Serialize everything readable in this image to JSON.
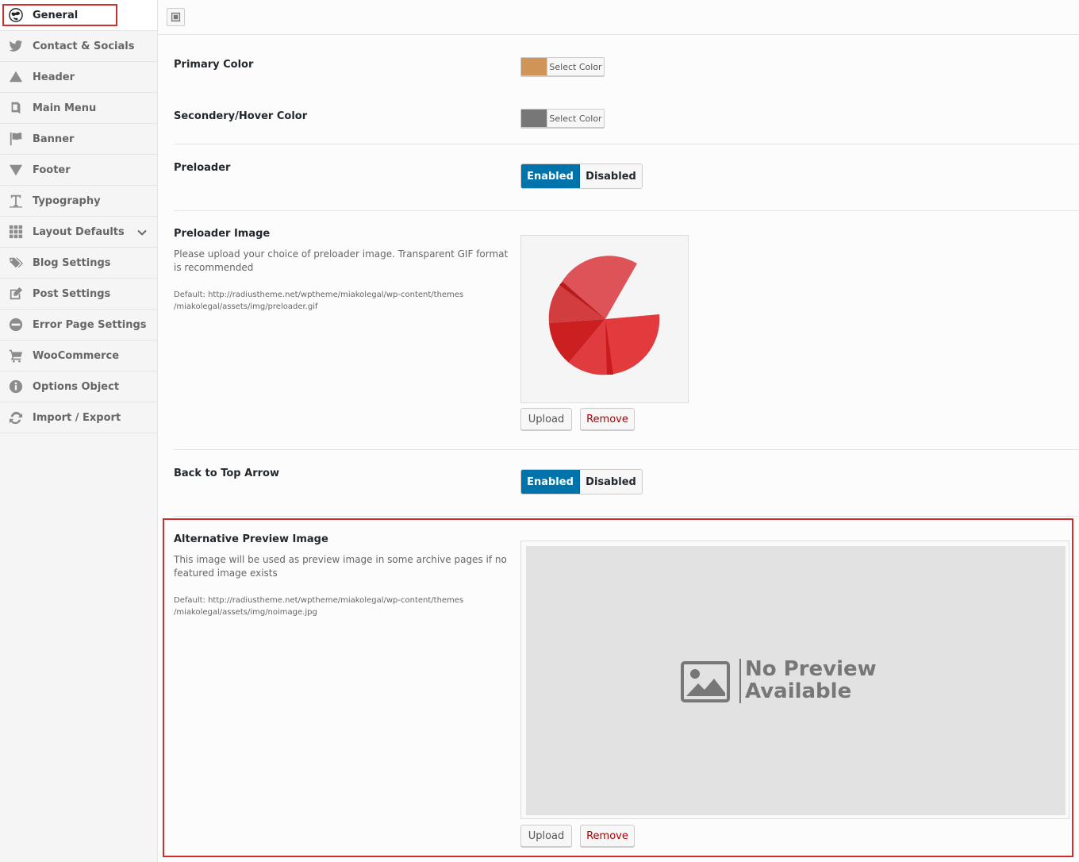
{
  "sidebar": {
    "items": [
      {
        "label": "General",
        "icon": "globe-icon"
      },
      {
        "label": "Contact & Socials",
        "icon": "twitter-icon"
      },
      {
        "label": "Header",
        "icon": "triangle-up-icon"
      },
      {
        "label": "Main Menu",
        "icon": "book-icon"
      },
      {
        "label": "Banner",
        "icon": "flag-icon"
      },
      {
        "label": "Footer",
        "icon": "triangle-down-icon"
      },
      {
        "label": "Typography",
        "icon": "text-icon"
      },
      {
        "label": "Layout Defaults",
        "icon": "grid-icon"
      },
      {
        "label": "Blog Settings",
        "icon": "tags-icon"
      },
      {
        "label": "Post Settings",
        "icon": "edit-icon"
      },
      {
        "label": "Error Page Settings",
        "icon": "minus-circle-icon"
      },
      {
        "label": "WooCommerce",
        "icon": "cart-icon"
      },
      {
        "label": "Options Object",
        "icon": "info-icon"
      },
      {
        "label": "Import / Export",
        "icon": "refresh-icon"
      }
    ]
  },
  "settings": {
    "primary_color": {
      "title": "Primary Color",
      "button": "Select Color",
      "value": "#d19457"
    },
    "secondary_color": {
      "title": "Secondery/Hover Color",
      "button": "Select Color",
      "value": "#777777"
    },
    "preloader": {
      "title": "Preloader",
      "on": "Enabled",
      "off": "Disabled"
    },
    "preloader_image": {
      "title": "Preloader Image",
      "desc": "Please upload your choice of preloader image. Transparent GIF format is recommended",
      "default_line1": "Default: http://radiustheme.net/wptheme/miakolegal/wp-content/themes",
      "default_line2": "/miakolegal/assets/img/preloader.gif",
      "upload": "Upload",
      "remove": "Remove"
    },
    "back_to_top": {
      "title": "Back to Top Arrow",
      "on": "Enabled",
      "off": "Disabled"
    },
    "alt_preview": {
      "title": "Alternative Preview Image",
      "desc": "This image will be used as preview image in some archive pages if no featured image exists",
      "default_line1": "Default: http://radiustheme.net/wptheme/miakolegal/wp-content/themes",
      "default_line2": "/miakolegal/assets/img/noimage.jpg",
      "placeholder_line1": "No Preview",
      "placeholder_line2": "Available",
      "upload": "Upload",
      "remove": "Remove"
    }
  },
  "colors": {
    "accent": "#0073aa",
    "highlight": "#cf2e2e"
  }
}
